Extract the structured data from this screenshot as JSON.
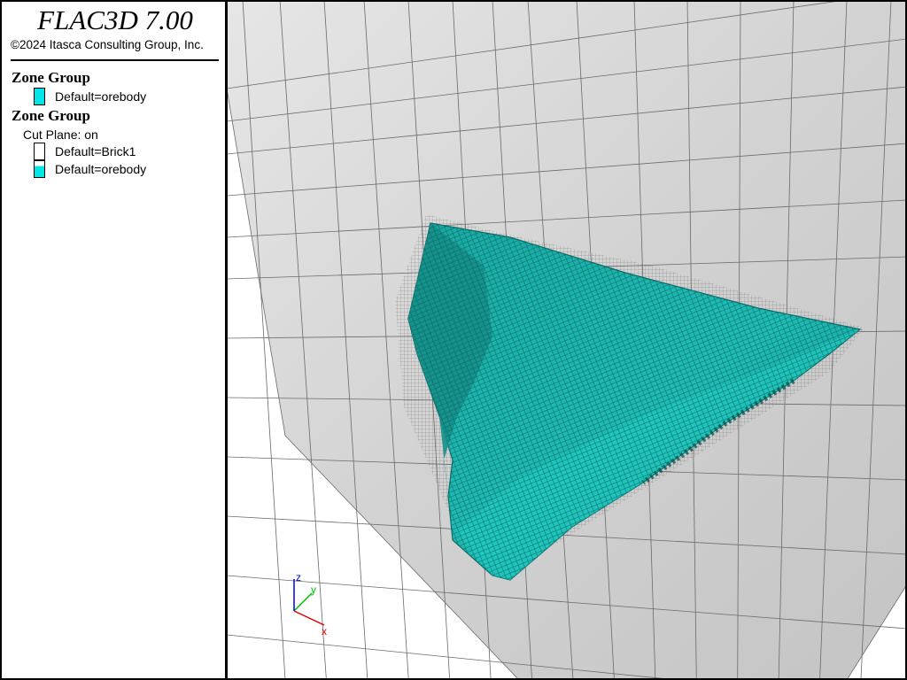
{
  "app": {
    "title": "FLAC3D 7.00",
    "copyright": "©2024 Itasca Consulting Group, Inc."
  },
  "legend": {
    "group1": {
      "heading": "Zone Group",
      "items": [
        {
          "label": "Default=orebody",
          "color": "#00e6e6"
        }
      ]
    },
    "group2": {
      "heading": "Zone Group",
      "cut_plane": "Cut Plane: on",
      "items": [
        {
          "label": "Default=Brick1",
          "color": "#ffffff"
        },
        {
          "label": "Default=orebody",
          "color": "#00e6e6"
        }
      ]
    }
  },
  "axes": {
    "x": "x",
    "y": "y",
    "z": "z"
  },
  "colors": {
    "orebody": "#1aa6a0",
    "orebody_light": "#22d8d0",
    "orebody_dark": "#0d6f6b",
    "mesh_face": "#dcdcdc",
    "mesh_line": "#6a6a6a",
    "axis_x": "#e00000",
    "axis_y": "#00c000",
    "axis_z": "#0000e0"
  }
}
